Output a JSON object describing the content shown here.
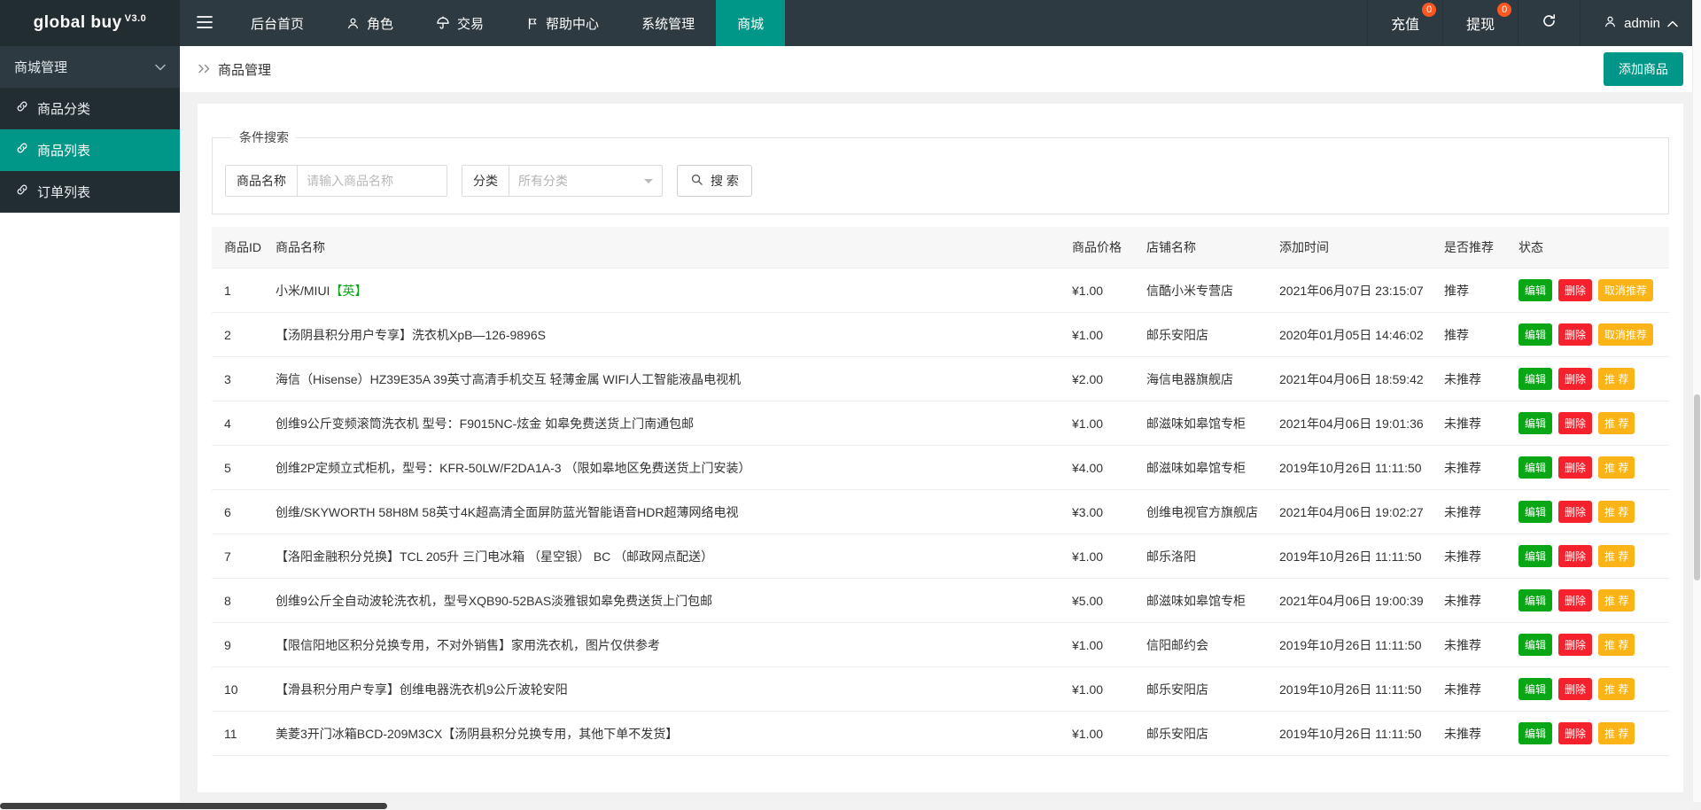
{
  "colors": {
    "dark-1": "#2d3a41",
    "dark-2": "#222d32",
    "accent": "#009688",
    "badge": "#ff5722",
    "btn-edit": "#09a716",
    "btn-delete": "#f5222d",
    "btn-warn": "#fbb417",
    "hl": "#09a716"
  },
  "topbar": {
    "logo": "global buy",
    "logo_version": "V3.0",
    "nav": [
      {
        "label": "后台首页"
      },
      {
        "label": "角色"
      },
      {
        "label": "交易"
      },
      {
        "label": "帮助中心"
      },
      {
        "label": "系统管理"
      },
      {
        "label": "商城"
      }
    ],
    "recharge": {
      "label": "充值",
      "badge": "0"
    },
    "withdraw": {
      "label": "提现",
      "badge": "0"
    },
    "user": {
      "name": "admin"
    }
  },
  "sidebar": {
    "header": "商城管理",
    "items": [
      {
        "label": "商品分类"
      },
      {
        "label": "商品列表"
      },
      {
        "label": "订单列表"
      }
    ]
  },
  "breadcrumb": {
    "title": "商品管理",
    "add_button": "添加商品"
  },
  "search": {
    "legend": "条件搜索",
    "name_label": "商品名称",
    "name_placeholder": "请输入商品名称",
    "category_label": "分类",
    "category_value": "所有分类",
    "search_button": "搜 索"
  },
  "table": {
    "headers": [
      "商品ID",
      "商品名称",
      "商品价格",
      "店铺名称",
      "添加时间",
      "是否推荐",
      "状态"
    ],
    "action_labels": {
      "edit": "编辑",
      "delete": "删除"
    },
    "rows": [
      {
        "id": "1",
        "name": "小米/MIUI",
        "name_highlight": "【英】",
        "price": "¥1.00",
        "store": "信酷小米专营店",
        "time": "2021年06月07日 23:15:07",
        "recommended": "推荐",
        "rec_action": "取消推荐"
      },
      {
        "id": "2",
        "name": "【汤阴县积分用户专享】洗衣机XpB—126-9896S",
        "name_highlight": "",
        "price": "¥1.00",
        "store": "邮乐安阳店",
        "time": "2020年01月05日 14:46:02",
        "recommended": "推荐",
        "rec_action": "取消推荐"
      },
      {
        "id": "3",
        "name": "海信（Hisense）HZ39E35A 39英寸高清手机交互 轻薄金属 WIFI人工智能液晶电视机",
        "name_highlight": "",
        "price": "¥2.00",
        "store": "海信电器旗舰店",
        "time": "2021年04月06日 18:59:42",
        "recommended": "未推荐",
        "rec_action": "推 荐"
      },
      {
        "id": "4",
        "name": "创维9公斤变频滚筒洗衣机 型号：F9015NC-炫金 如皋免费送货上门南通包邮",
        "name_highlight": "",
        "price": "¥1.00",
        "store": "邮滋味如皋馆专柜",
        "time": "2021年04月06日 19:01:36",
        "recommended": "未推荐",
        "rec_action": "推 荐"
      },
      {
        "id": "5",
        "name": "创维2P定频立式柜机，型号：KFR-50LW/F2DA1A-3 （限如皋地区免费送货上门安装）",
        "name_highlight": "",
        "price": "¥4.00",
        "store": "邮滋味如皋馆专柜",
        "time": "2019年10月26日 11:11:50",
        "recommended": "未推荐",
        "rec_action": "推 荐"
      },
      {
        "id": "6",
        "name": "创维/SKYWORTH 58H8M 58英寸4K超高清全面屏防蓝光智能语音HDR超薄网络电视",
        "name_highlight": "",
        "price": "¥3.00",
        "store": "创维电视官方旗舰店",
        "time": "2021年04月06日 19:02:27",
        "recommended": "未推荐",
        "rec_action": "推 荐"
      },
      {
        "id": "7",
        "name": "【洛阳金融积分兑换】TCL 205升 三门电冰箱 （星空银） BC （邮政网点配送）",
        "name_highlight": "",
        "price": "¥1.00",
        "store": "邮乐洛阳",
        "time": "2019年10月26日 11:11:50",
        "recommended": "未推荐",
        "rec_action": "推 荐"
      },
      {
        "id": "8",
        "name": "创维9公斤全自动波轮洗衣机，型号XQB90-52BAS淡雅银如皋免费送货上门包邮",
        "name_highlight": "",
        "price": "¥5.00",
        "store": "邮滋味如皋馆专柜",
        "time": "2021年04月06日 19:00:39",
        "recommended": "未推荐",
        "rec_action": "推 荐"
      },
      {
        "id": "9",
        "name": "【限信阳地区积分兑换专用，不对外销售】家用洗衣机，图片仅供参考",
        "name_highlight": "",
        "price": "¥1.00",
        "store": "信阳邮约会",
        "time": "2019年10月26日 11:11:50",
        "recommended": "未推荐",
        "rec_action": "推 荐"
      },
      {
        "id": "10",
        "name": "【滑县积分用户专享】创维电器洗衣机9公斤波轮安阳",
        "name_highlight": "",
        "price": "¥1.00",
        "store": "邮乐安阳店",
        "time": "2019年10月26日 11:11:50",
        "recommended": "未推荐",
        "rec_action": "推 荐"
      },
      {
        "id": "11",
        "name": "美菱3开门冰箱BCD-209M3CX【汤阴县积分兑换专用，其他下单不发货】",
        "name_highlight": "",
        "price": "¥1.00",
        "store": "邮乐安阳店",
        "time": "2019年10月26日 11:11:50",
        "recommended": "未推荐",
        "rec_action": "推 荐"
      }
    ]
  }
}
